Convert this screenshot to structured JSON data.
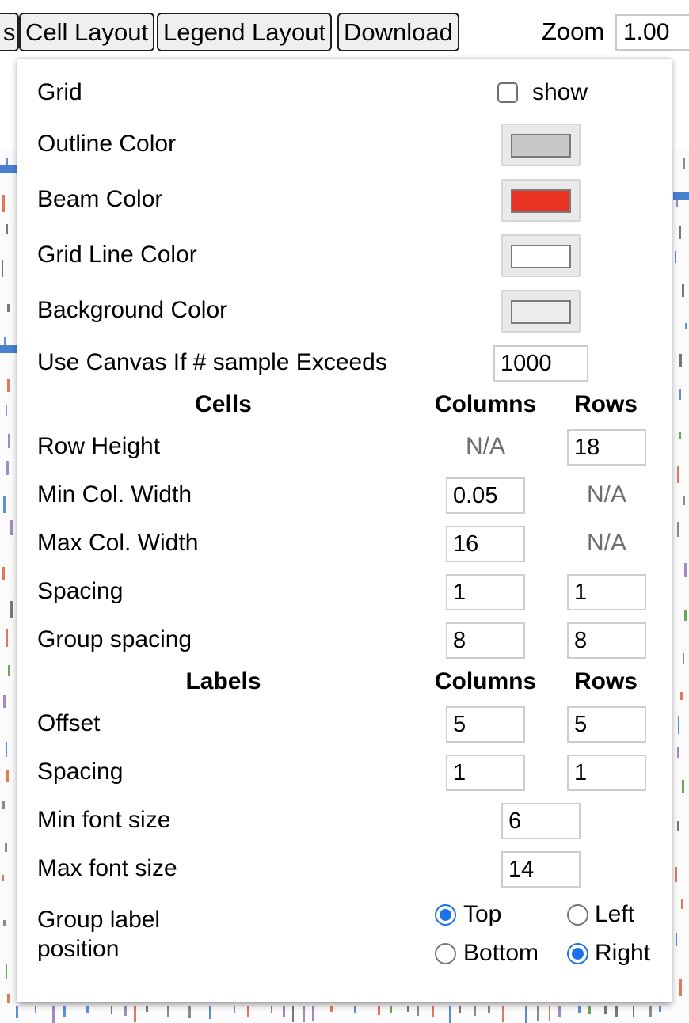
{
  "toolbar": {
    "prev_tab_fragment": "s",
    "cell_layout": "Cell Layout",
    "legend_layout": "Legend Layout",
    "download": "Download",
    "zoom_label": "Zoom",
    "zoom_value": "1.00"
  },
  "panel": {
    "grid": {
      "label": "Grid",
      "checkbox_label": "show",
      "checked": false
    },
    "outline_color": {
      "label": "Outline Color",
      "color": "#c8c8c8"
    },
    "beam_color": {
      "label": "Beam Color",
      "color": "#ea3323"
    },
    "grid_line_color": {
      "label": "Grid Line Color",
      "color": "#ffffff"
    },
    "background_color": {
      "label": "Background Color",
      "color": "#ececec"
    },
    "canvas_threshold": {
      "label": "Use Canvas If # sample Exceeds",
      "value": "1000"
    },
    "cells_header": {
      "title": "Cells",
      "columns": "Columns",
      "rows": "Rows"
    },
    "row_height": {
      "label": "Row Height",
      "columns": "N/A",
      "rows": "18"
    },
    "min_col_width": {
      "label": "Min Col. Width",
      "columns": "0.05",
      "rows": "N/A"
    },
    "max_col_width": {
      "label": "Max Col. Width",
      "columns": "16",
      "rows": "N/A"
    },
    "cell_spacing": {
      "label": "Spacing",
      "columns": "1",
      "rows": "1"
    },
    "group_spacing": {
      "label": "Group spacing",
      "columns": "8",
      "rows": "8"
    },
    "labels_header": {
      "title": "Labels",
      "columns": "Columns",
      "rows": "Rows"
    },
    "offset": {
      "label": "Offset",
      "columns": "5",
      "rows": "5"
    },
    "label_spacing": {
      "label": "Spacing",
      "columns": "1",
      "rows": "1"
    },
    "min_font": {
      "label": "Min font size",
      "value": "6"
    },
    "max_font": {
      "label": "Max font size",
      "value": "14"
    },
    "group_label_position": {
      "label_line1": "Group label",
      "label_line2": "position",
      "column_options": [
        "Top",
        "Bottom"
      ],
      "column_selected": "Top",
      "row_options": [
        "Left",
        "Right"
      ],
      "row_selected": "Right"
    }
  }
}
